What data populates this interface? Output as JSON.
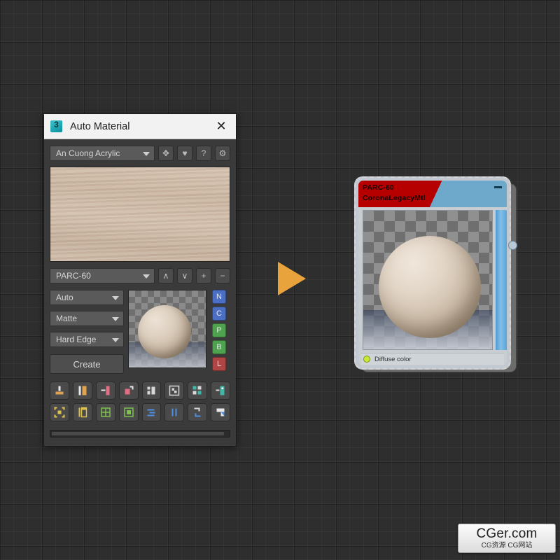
{
  "dialog": {
    "title": "Auto Material",
    "app_icon": "3dsmax-icon",
    "close_label": "✕",
    "material_select": {
      "value": "An Cuong Acrylic",
      "icon": "chevron-down-icon"
    },
    "header_buttons": [
      {
        "name": "move-tool-button",
        "glyph": "✥"
      },
      {
        "name": "favorite-button",
        "glyph": "♥"
      },
      {
        "name": "help-button",
        "glyph": "?"
      },
      {
        "name": "settings-button",
        "glyph": "⚙"
      }
    ],
    "preset_select": {
      "value": "PARC-60"
    },
    "preset_buttons": [
      {
        "name": "move-up-button",
        "glyph": "∧"
      },
      {
        "name": "move-down-button",
        "glyph": "∨"
      },
      {
        "name": "add-preset-button",
        "glyph": "+"
      },
      {
        "name": "remove-preset-button",
        "glyph": "−"
      }
    ],
    "options": [
      {
        "name": "mapping-mode-select",
        "value": "Auto"
      },
      {
        "name": "finish-select",
        "value": "Matte"
      },
      {
        "name": "edge-select",
        "value": "Hard Edge"
      }
    ],
    "create_label": "Create",
    "channel_buttons": [
      {
        "label": "N",
        "color": "#4a6fc4"
      },
      {
        "label": "C",
        "color": "#4a6fc4"
      },
      {
        "label": "P",
        "color": "#4fa34f"
      },
      {
        "label": "B",
        "color": "#4fa34f"
      },
      {
        "label": "L",
        "color": "#b04545"
      }
    ],
    "tool_buttons_row1": [
      {
        "name": "tool-apply-material",
        "color": "#e0a250"
      },
      {
        "name": "tool-panel-split",
        "color": "#e0a250"
      },
      {
        "name": "tool-align-left",
        "color": "#e06f86"
      },
      {
        "name": "tool-corner-fold",
        "color": "#e06f86"
      },
      {
        "name": "tool-columns",
        "color": "#d8d8d8"
      },
      {
        "name": "tool-checker",
        "color": "#d8d8d8"
      },
      {
        "name": "tool-grid-cells",
        "color": "#3fb8a8"
      },
      {
        "name": "tool-panel-right",
        "color": "#3fb8a8"
      }
    ],
    "tool_buttons_row2": [
      {
        "name": "tool-select-region",
        "color": "#e0c24e"
      },
      {
        "name": "tool-side-panel",
        "color": "#e0c24e"
      },
      {
        "name": "tool-grid-four",
        "color": "#7fc04e"
      },
      {
        "name": "tool-frame-fill",
        "color": "#7fc04e"
      },
      {
        "name": "tool-distribute-h",
        "color": "#4d90e0"
      },
      {
        "name": "tool-bars-vertical",
        "color": "#4d90e0"
      },
      {
        "name": "tool-rotate",
        "color": "#4d90e0"
      },
      {
        "name": "tool-corner-shape",
        "color": "#4d90e0"
      }
    ],
    "scrollbar": {
      "name": "horizontal-scrollbar"
    }
  },
  "flow": {
    "arrow_name": "flow-arrow-right",
    "color": "#e8a33d"
  },
  "node": {
    "title_line1": "PARC-60",
    "title_line2": "CoronaLegacyMtl",
    "minimize_name": "node-minimize-button",
    "slot_label": "Diffuse color",
    "slot_dot_color": "#c9e83a",
    "header_color_left": "#b60000",
    "header_color_right": "#6ea9cc",
    "socket_name": "node-output-socket"
  },
  "watermark": {
    "main": "CGer.com",
    "sub": "CG资源 CG网站"
  }
}
